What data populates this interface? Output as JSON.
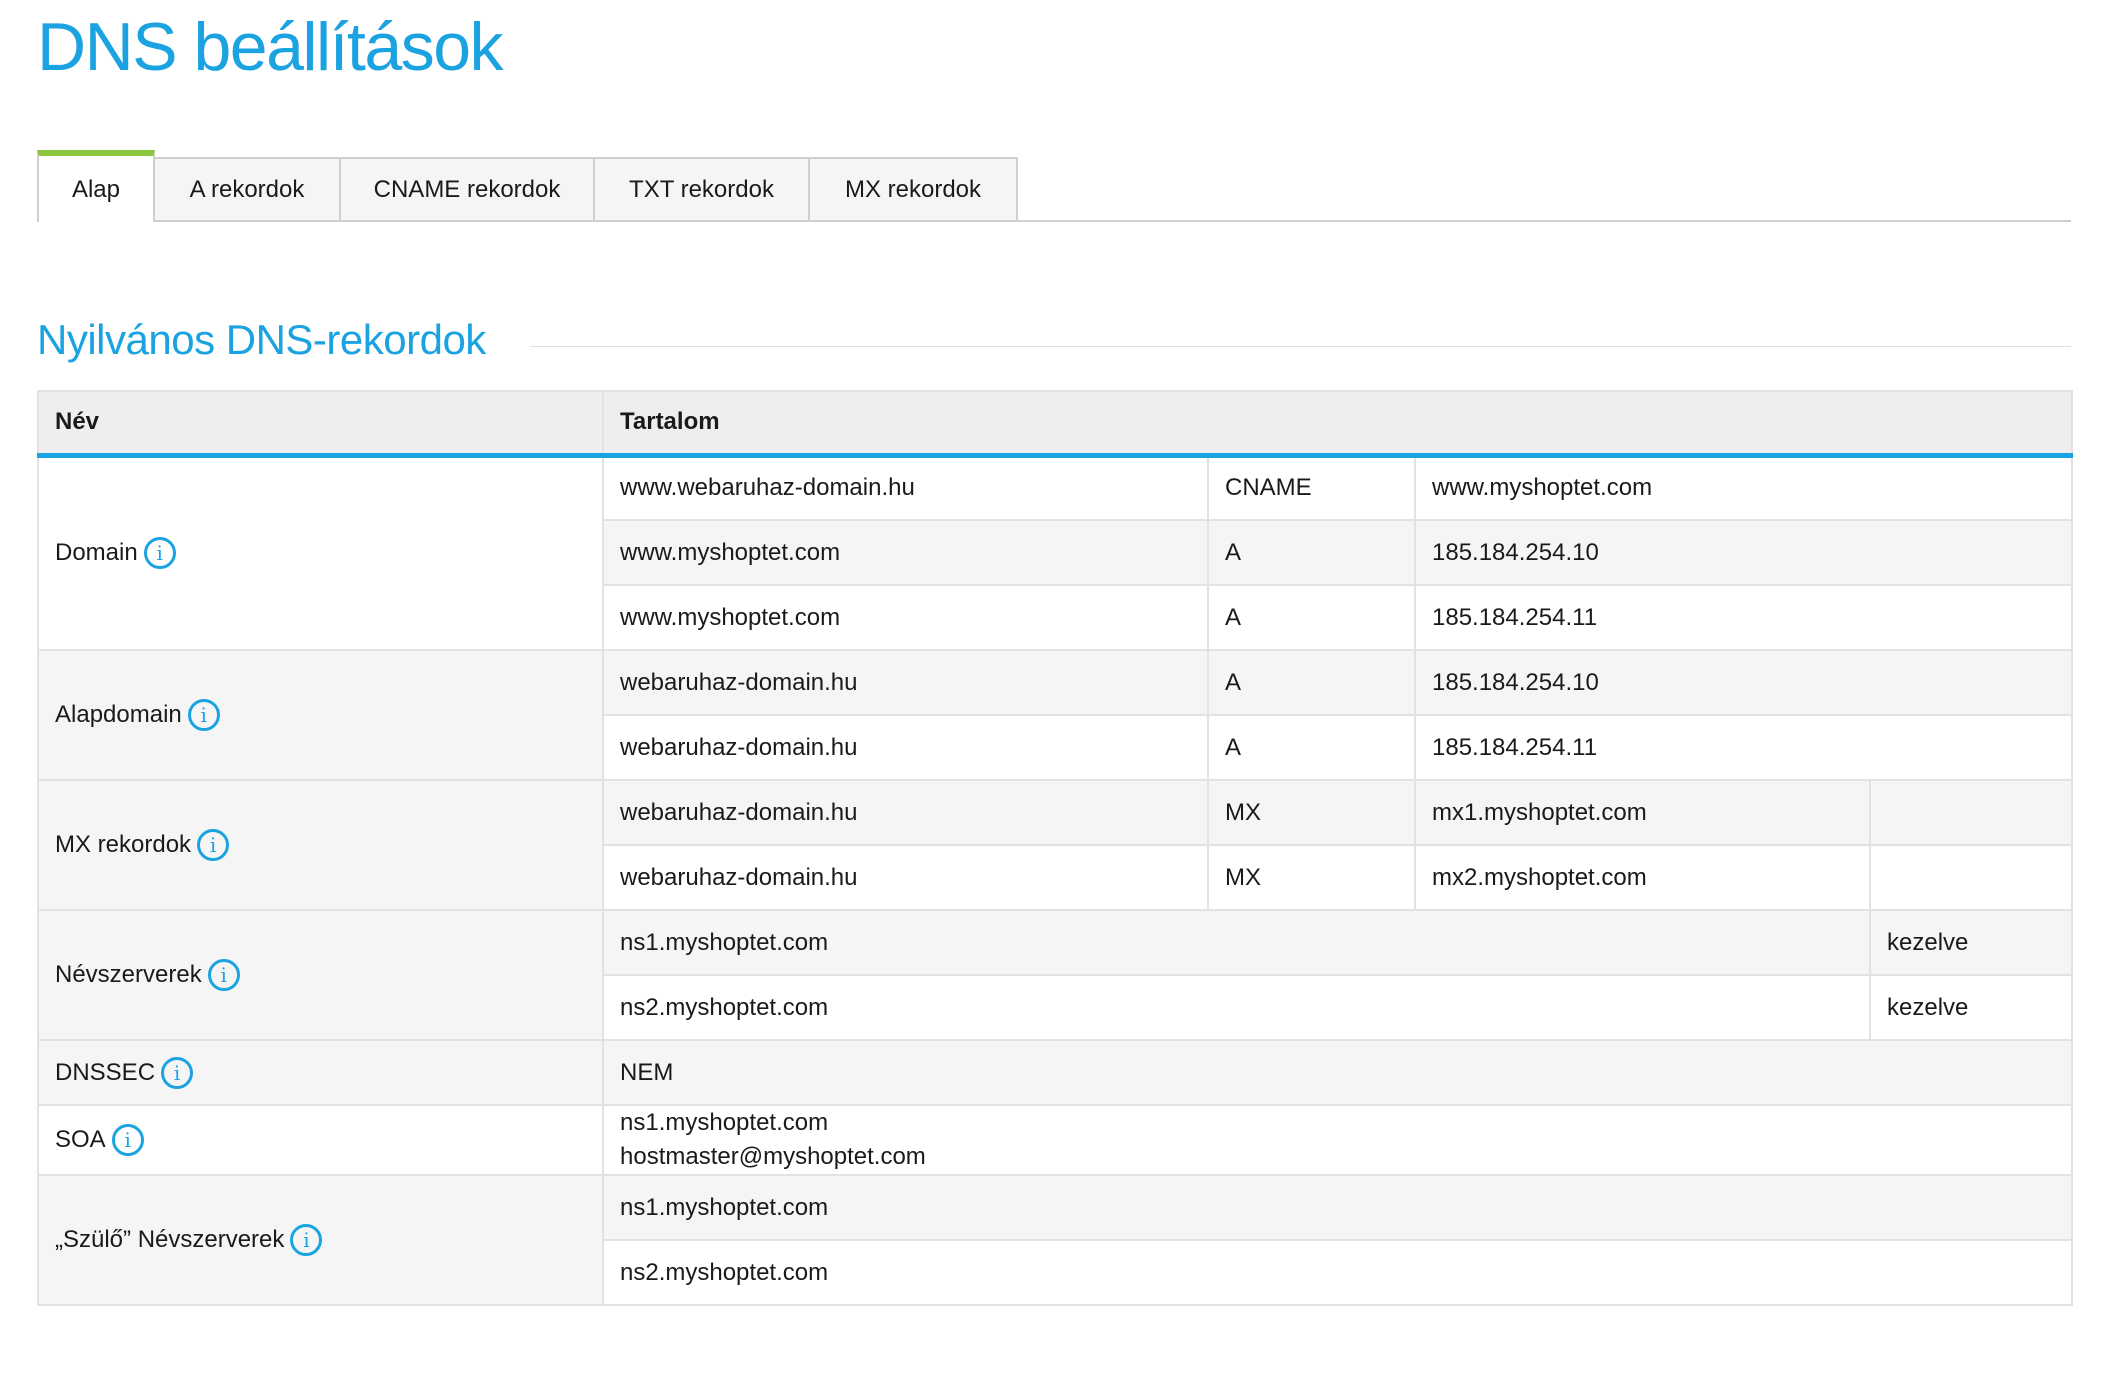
{
  "title": "DNS beállítások",
  "tabs": [
    "Alap",
    "A rekordok",
    "CNAME rekordok",
    "TXT rekordok",
    "MX rekordok"
  ],
  "section": "Nyilvános DNS-rekordok",
  "table": {
    "col_name": "Név",
    "col_content": "Tartalom",
    "domain": {
      "label": "Domain",
      "rows": [
        [
          "www.webaruhaz-domain.hu",
          "CNAME",
          "www.myshoptet.com"
        ],
        [
          "www.myshoptet.com",
          "A",
          "185.184.254.10"
        ],
        [
          "www.myshoptet.com",
          "A",
          "185.184.254.11"
        ]
      ]
    },
    "alapdomain": {
      "label": "Alapdomain",
      "rows": [
        [
          "webaruhaz-domain.hu",
          "A",
          "185.184.254.10"
        ],
        [
          "webaruhaz-domain.hu",
          "A",
          "185.184.254.11"
        ]
      ]
    },
    "mx": {
      "label": "MX rekordok",
      "rows": [
        [
          "webaruhaz-domain.hu",
          "MX",
          "mx1.myshoptet.com"
        ],
        [
          "webaruhaz-domain.hu",
          "MX",
          "mx2.myshoptet.com"
        ]
      ]
    },
    "ns": {
      "label": "Névszerverek",
      "rows": [
        [
          "ns1.myshoptet.com",
          "kezelve"
        ],
        [
          "ns2.myshoptet.com",
          "kezelve"
        ]
      ]
    },
    "dnssec": {
      "label": "DNSSEC",
      "value": "NEM"
    },
    "soa": {
      "label": "SOA",
      "line1": "ns1.myshoptet.com",
      "line2": "hostmaster@myshoptet.com"
    },
    "parent_ns": {
      "label": "„Szülő” Névszerverek",
      "rows": [
        "ns1.myshoptet.com",
        "ns2.myshoptet.com"
      ]
    }
  }
}
